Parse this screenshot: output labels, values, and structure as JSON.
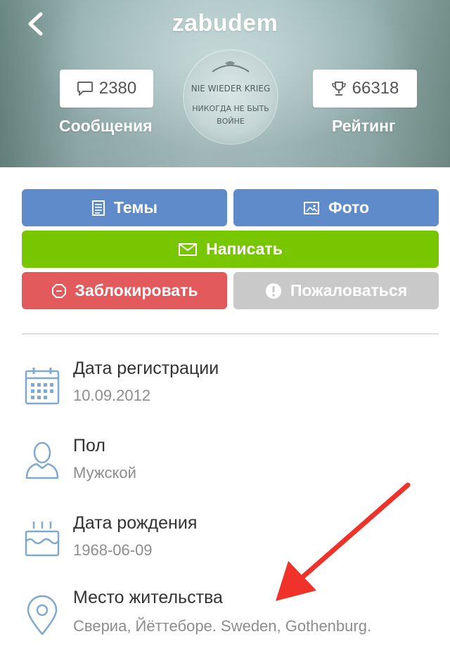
{
  "header": {
    "username": "zabudem",
    "messages_count": "2380",
    "messages_label": "Сообщения",
    "rating_count": "66318",
    "rating_label": "Рейтинг",
    "avatar_text_line1": "NIE WIEDER KRIEG",
    "avatar_text_line2": "НИКОГДА НЕ БЫТЬ",
    "avatar_text_line3": "ВОЙНЕ"
  },
  "actions": {
    "topics_label": "Темы",
    "photo_label": "Фото",
    "write_label": "Написать",
    "block_label": "Заблокировать",
    "report_label": "Пожаловаться"
  },
  "info": [
    {
      "title": "Дата регистрации",
      "value": "10.09.2012",
      "icon": "calendar-icon"
    },
    {
      "title": "Пол",
      "value": "Мужской",
      "icon": "user-icon"
    },
    {
      "title": "Дата рождения",
      "value": "1968-06-09",
      "icon": "birthday-cake-icon"
    },
    {
      "title": "Место жительства",
      "value": "Свериа, Йёттеборе. Sweden, Gothenburg.",
      "icon": "location-pin-icon"
    }
  ],
  "colors": {
    "blue": "#5f8bcb",
    "green": "#78c600",
    "red": "#e35a5d",
    "gray": "#c9c9c9",
    "icon_blue": "#7fa9d1",
    "arrow_red": "#f0332a"
  }
}
